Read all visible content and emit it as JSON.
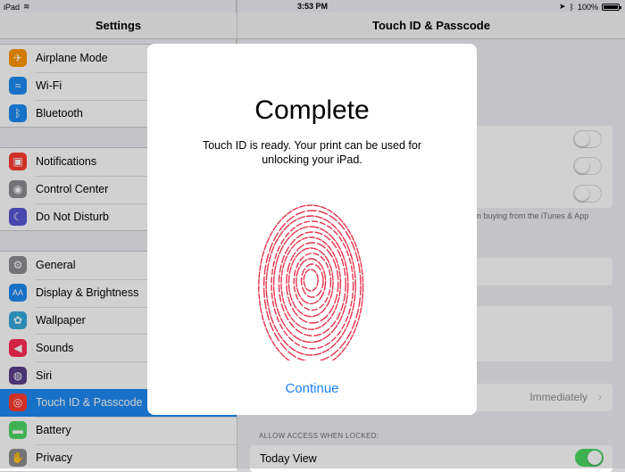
{
  "status_bar": {
    "device": "iPad",
    "time": "3:53 PM",
    "battery": "100%"
  },
  "master": {
    "title": "Settings",
    "groups": [
      [
        {
          "label": "Airplane Mode",
          "icon": "airplane-icon",
          "color": "#ff9500",
          "glyph": "✈"
        },
        {
          "label": "Wi-Fi",
          "icon": "wifi-icon",
          "color": "#1d8af3",
          "glyph": "≈"
        },
        {
          "label": "Bluetooth",
          "icon": "bluetooth-icon",
          "color": "#1d8af3",
          "glyph": "ᛒ"
        }
      ],
      [
        {
          "label": "Notifications",
          "icon": "notifications-icon",
          "color": "#ff3b30",
          "glyph": "▣"
        },
        {
          "label": "Control Center",
          "icon": "control-center-icon",
          "color": "#8e8e93",
          "glyph": "◉"
        },
        {
          "label": "Do Not Disturb",
          "icon": "moon-icon",
          "color": "#5856d6",
          "glyph": "☾"
        }
      ],
      [
        {
          "label": "General",
          "icon": "gear-icon",
          "color": "#8e8e93",
          "glyph": "⚙"
        },
        {
          "label": "Display & Brightness",
          "icon": "display-icon",
          "color": "#1d8af3",
          "glyph": "AA"
        },
        {
          "label": "Wallpaper",
          "icon": "wallpaper-icon",
          "color": "#34aadc",
          "glyph": "✿"
        },
        {
          "label": "Sounds",
          "icon": "speaker-icon",
          "color": "#ff2d55",
          "glyph": "◀"
        },
        {
          "label": "Siri",
          "icon": "siri-icon",
          "color": "#5a3f8a",
          "glyph": "◍"
        },
        {
          "label": "Touch ID & Passcode",
          "icon": "fingerprint-icon",
          "color": "#ff3b30",
          "glyph": "◎",
          "selected": true
        },
        {
          "label": "Battery",
          "icon": "battery-icon",
          "color": "#4cd964",
          "glyph": "▬"
        },
        {
          "label": "Privacy",
          "icon": "hand-icon",
          "color": "#8e8e93",
          "glyph": "✋"
        }
      ]
    ]
  },
  "detail": {
    "title": "Touch ID & Passcode",
    "footnote": "n buying from the iTunes & App",
    "require_value": "Immediately",
    "section_caption": "ALLOW ACCESS WHEN LOCKED:",
    "today_view": "Today View"
  },
  "modal": {
    "title": "Complete",
    "body": "Touch ID is ready. Your print can be used for unlocking your iPad.",
    "continue_label": "Continue",
    "fingerprint_color": "#e8334c"
  }
}
